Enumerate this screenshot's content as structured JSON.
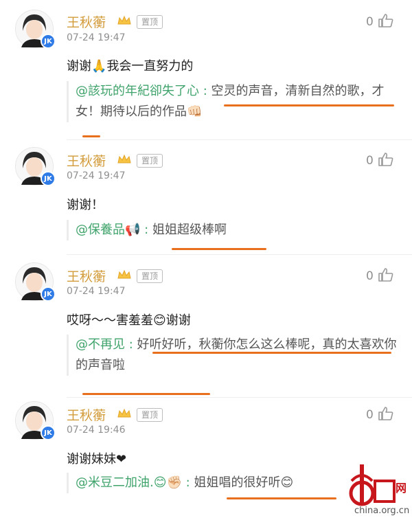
{
  "comments": [
    {
      "user": "王秋蘅",
      "badge": "置顶",
      "time": "07-24 19:47",
      "likes": "0",
      "text": "谢谢🙏我会一直努力的",
      "reply_user": "@該玩的年紀卻失了心",
      "reply_sep": ":",
      "reply_text": "空灵的声音，清新自然的歌，才女！期待以后的作品👊🏻"
    },
    {
      "user": "王秋蘅",
      "badge": "置顶",
      "time": "07-24 19:47",
      "likes": "0",
      "text": "谢谢！",
      "reply_user": "@保養品📢",
      "reply_sep": ":",
      "reply_text": "姐姐超级棒啊"
    },
    {
      "user": "王秋蘅",
      "badge": "置顶",
      "time": "07-24 19:47",
      "likes": "0",
      "text": "哎呀～～害羞羞😊谢谢",
      "reply_user": "@不再见",
      "reply_sep": ":",
      "reply_text": "好听好听，秋蘅你怎么这么棒呢，真的太喜欢你的声音啦"
    },
    {
      "user": "王秋蘅",
      "badge": "置顶",
      "time": "07-24 19:46",
      "likes": "0",
      "text": "谢谢妹妹❤",
      "reply_user": "@米豆二加油.😊✊🏻",
      "reply_sep": ":",
      "reply_text": "姐姐唱的很好听😊"
    }
  ],
  "watermark": {
    "site": "china.org.cn",
    "logo_text": "中国网"
  },
  "colors": {
    "username": "#d39c3b",
    "at_user": "#3fa36b",
    "underline": "#e8701d",
    "verified": "#2e7ae6"
  }
}
